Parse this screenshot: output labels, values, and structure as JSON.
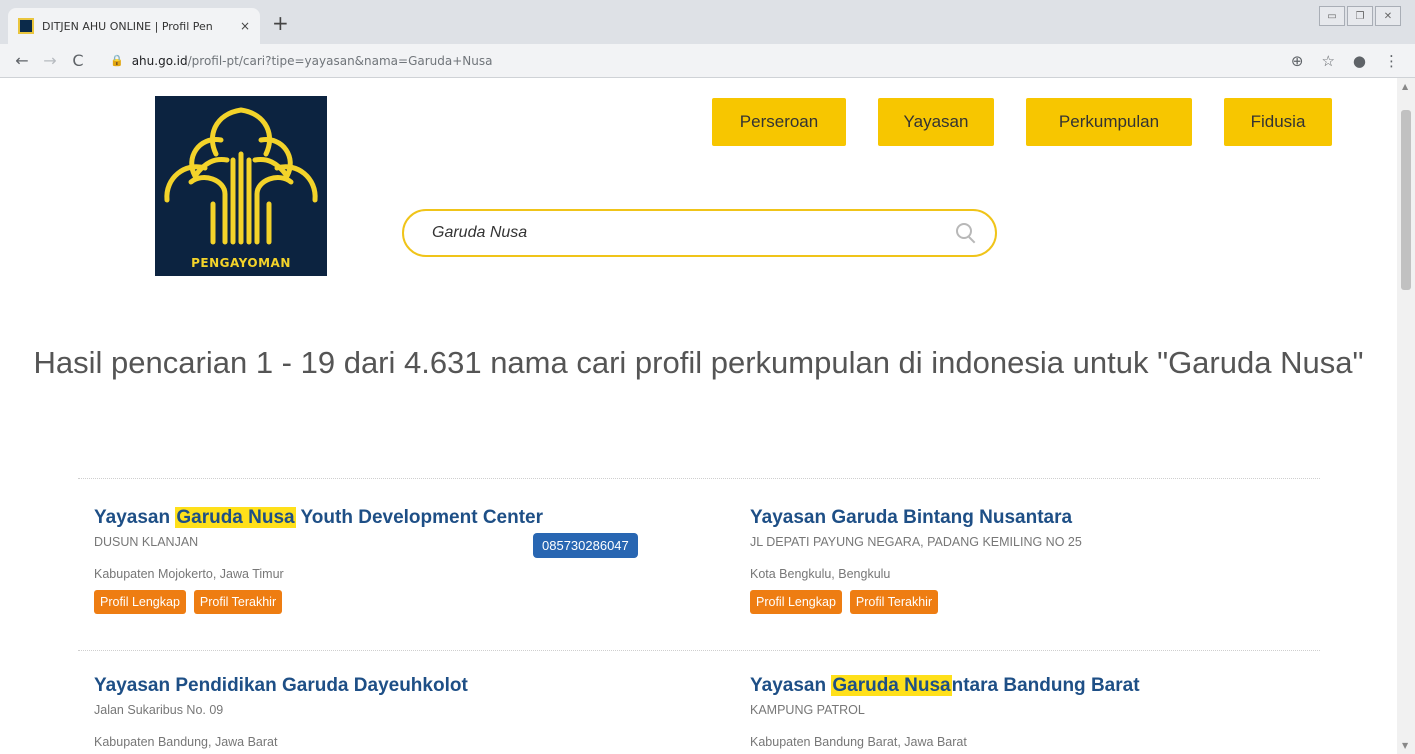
{
  "browser": {
    "tab_title": "DITJEN AHU ONLINE | Profil Pen",
    "tab_close": "×",
    "new_tab": "+",
    "url_host": "ahu.go.id",
    "url_path": "/profil-pt/cari?tipe=yayasan&nama=Garuda+Nusa",
    "window_controls": [
      "▭",
      "❐",
      "✕"
    ]
  },
  "logo": {
    "text": "PENGAYOMAN"
  },
  "nav": {
    "items": [
      {
        "label": "Perseroan"
      },
      {
        "label": "Yayasan"
      },
      {
        "label": "Perkumpulan"
      },
      {
        "label": "Fidusia"
      }
    ]
  },
  "search": {
    "value": "Garuda Nusa"
  },
  "results": {
    "heading": "Hasil pencarian 1 - 19 dari 4.631 nama cari profil perkumpulan di indonesia untuk \"Garuda Nusa\"",
    "items": [
      {
        "name_pre": "Yayasan ",
        "name_hl": "Garuda Nusa",
        "name_post": " Youth Development Center",
        "address": "DUSUN KLANJAN",
        "location": "Kabupaten Mojokerto, Jawa Timur",
        "phone": "085730286047",
        "btn_full": "Profil Lengkap",
        "btn_last": "Profil Terakhir"
      },
      {
        "name_pre": "Yayasan Garuda Bintang Nusantara",
        "address": "JL DEPATI PAYUNG NEGARA, PADANG KEMILING NO 25",
        "location": "Kota Bengkulu, Bengkulu",
        "btn_full": "Profil Lengkap",
        "btn_last": "Profil Terakhir"
      },
      {
        "name_pre": "Yayasan Pendidikan Garuda Dayeuhkolot",
        "address": "Jalan Sukaribus No. 09",
        "location": "Kabupaten Bandung, Jawa Barat"
      },
      {
        "name_pre": "Yayasan ",
        "name_hl": "Garuda Nusa",
        "name_post": "ntara Bandung Barat",
        "address": "KAMPUNG PATROL",
        "location": "Kabupaten Bandung Barat, Jawa Barat"
      }
    ]
  },
  "colors": {
    "nav_yellow": "#f7c600",
    "link_blue": "#1e4f86",
    "action_orange": "#ee7d12",
    "phone_blue": "#2866b2",
    "highlight": "#ffe01a"
  }
}
